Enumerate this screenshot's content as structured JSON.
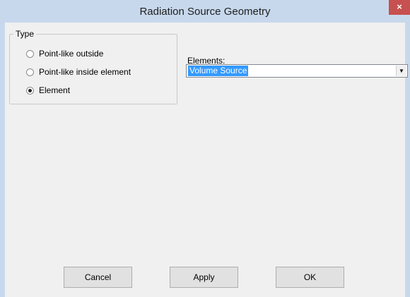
{
  "window": {
    "title": "Radiation Source Geometry",
    "close_glyph": "×"
  },
  "type_group": {
    "label": "Type",
    "options": [
      {
        "label": "Point-like outside",
        "checked": false
      },
      {
        "label": "Point-like inside element",
        "checked": false
      },
      {
        "label": "Element",
        "checked": true
      }
    ]
  },
  "elements": {
    "label": "Elements:",
    "selected": "Volume Source",
    "arrow_glyph": "▼"
  },
  "buttons": {
    "cancel": "Cancel",
    "apply": "Apply",
    "ok": "OK"
  },
  "colors": {
    "titlebar": "#c8d8ec",
    "close": "#c75050",
    "selection": "#3399ff"
  }
}
